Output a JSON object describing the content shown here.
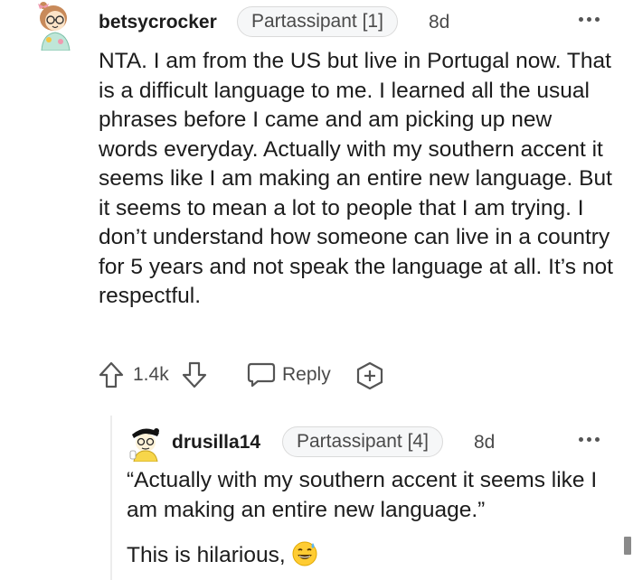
{
  "comment": {
    "username": "betsycrocker",
    "flair": "Partassipant [1]",
    "age": "8d",
    "body": "NTA. I am from the US but live in Portugal now. That is a difficult language to me. I learned all the usual phrases before I came and am picking up new words everyday. Actually with my southern accent it seems like I am making an entire new language. But it seems to mean a lot to people that I am trying. I don’t understand how someone can live in a country for 5 years and not speak the language at all. It’s not respectful.",
    "score": "1.4k",
    "reply_label": "Reply"
  },
  "reply": {
    "username": "drusilla14",
    "flair": "Partassipant [4]",
    "age": "8d",
    "quote": "“Actually with my southern accent it seems like I am making an entire new language.”",
    "text": "This is hilarious,",
    "emoji_icon": "grinning-sweat-emoji"
  },
  "icons": {
    "upvote": "upvote-arrow-icon",
    "downvote": "downvote-arrow-icon",
    "reply": "speech-bubble-icon",
    "award": "award-plus-icon",
    "more": "more-dots-icon"
  },
  "colors": {
    "text": "#1c1c1c",
    "meta": "#4a4a4a",
    "flair_bg": "#f6f7f8",
    "flair_border": "#dadada",
    "thread_line": "#ececec"
  }
}
